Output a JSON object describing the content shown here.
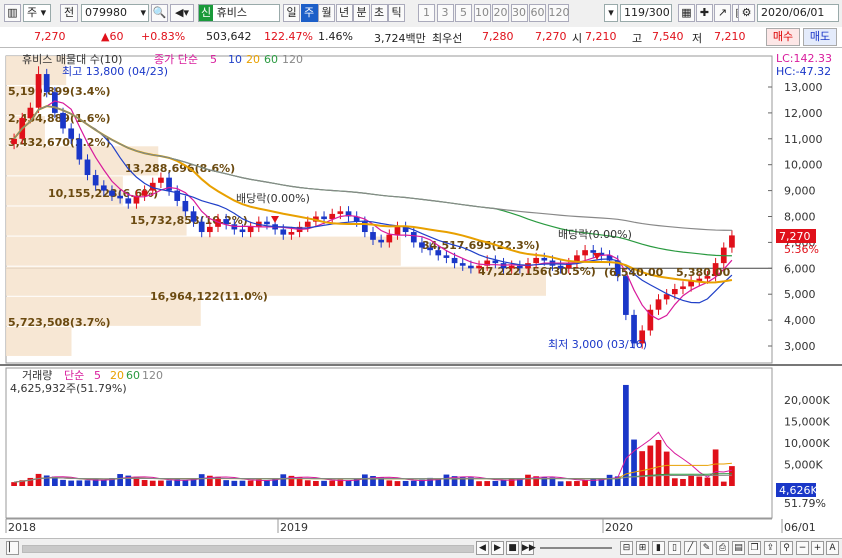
{
  "toolbar": {
    "menu_glyph": "▥",
    "type": "주",
    "prev": "전",
    "code": "079980",
    "search_glyph": "🔍",
    "sound_glyph": "◀▾",
    "market_badge": "신",
    "name": "휴비스",
    "periods": [
      "일",
      "주",
      "월",
      "년",
      "분",
      "초",
      "틱"
    ],
    "active_period": "주",
    "nums": [
      "1",
      "3",
      "5",
      "10",
      "20",
      "30",
      "60",
      "120"
    ],
    "count": "119",
    "count_total": "/300",
    "date": "2020/06/01"
  },
  "quote": {
    "price": "7,270",
    "change": "▲60",
    "change_pct": "+0.83%",
    "volume": "503,642",
    "volume_ratio": "122.47%",
    "turnover": "1.46%",
    "amount": "3,724백만",
    "best_label": "최우선",
    "ask": "7,280",
    "bid": "7,270",
    "open_label": "시",
    "open": "7,210",
    "high_label": "고",
    "high": "7,540",
    "low_label": "저",
    "low": "7,210",
    "buy": "매수",
    "sell": "매도"
  },
  "price_panel": {
    "legend_name": "휴비스 매물대 수(10)",
    "ma_label": "종가 단순",
    "ma_periods": [
      "5",
      "10",
      "20",
      "60",
      "120"
    ],
    "ma_colors": [
      "#d81b9c",
      "#2040c8",
      "#e8a000",
      "#2a9a40",
      "#888888"
    ],
    "lc": "LC:142.33",
    "hc": "HC:-47.32",
    "current_price": "7,270",
    "current_pct": "5.36%",
    "y_ticks": [
      "13,000",
      "12,000",
      "11,000",
      "10,000",
      "9,000",
      "8,000",
      "7,000",
      "6,000",
      "5,000",
      "4,000",
      "3,000"
    ],
    "high_note": "최고 13,800 (04/23)",
    "low_note": "최저 3,000 (03/16)",
    "dividend_1": "배당락(0.00%)",
    "dividend_2": "배당락(0.00%)",
    "volume_profile": [
      {
        "label": "5,199,899(3.4%)",
        "value": 5199899,
        "pct": 3.4
      },
      {
        "label": "2,454,889(1.6%)",
        "value": 2454889,
        "pct": 1.6
      },
      {
        "label": "3,432,670(2.2%)",
        "value": 3432670,
        "pct": 2.2
      },
      {
        "label": "13,288,696(8.6%)",
        "value": 13288696,
        "pct": 8.6
      },
      {
        "label": "10,155,223(6.6%)",
        "value": 10155223,
        "pct": 6.6
      },
      {
        "label": "15,732,858(10.2%)",
        "value": 15732858,
        "pct": 10.2
      },
      {
        "label": "34,517,695(22.3%)",
        "value": 34517695,
        "pct": 22.3
      },
      {
        "label": "47,222,156(30.5%)",
        "value": 47222156,
        "pct": 30.5
      },
      {
        "label": "16,964,122(11.0%)",
        "value": 16964122,
        "pct": 11.0
      },
      {
        "label": "5,723,508(3.7%)",
        "value": 5723508,
        "pct": 3.7
      }
    ],
    "other_note": "5,380.00",
    "other_note_2": "(6,540.00"
  },
  "volume_panel": {
    "legend_name": "거래량",
    "ma_label": "단순",
    "ma_periods": [
      "5",
      "20",
      "60",
      "120"
    ],
    "ma_colors": [
      "#d81b9c",
      "#e8a000",
      "#2a9a40",
      "#888888"
    ],
    "summary": "4,625,932주(51.79%)",
    "y_ticks": [
      "20,000K",
      "15,000K",
      "10,000K",
      "5,000K"
    ],
    "current": "4,626K",
    "current_pct": "51.79%"
  },
  "x_axis": {
    "labels": [
      "2018",
      "2019",
      "2020",
      "06/01"
    ]
  },
  "colors": {
    "up": "#e0101a",
    "down": "#1a37c8",
    "accent": "#1d5fc8"
  }
}
